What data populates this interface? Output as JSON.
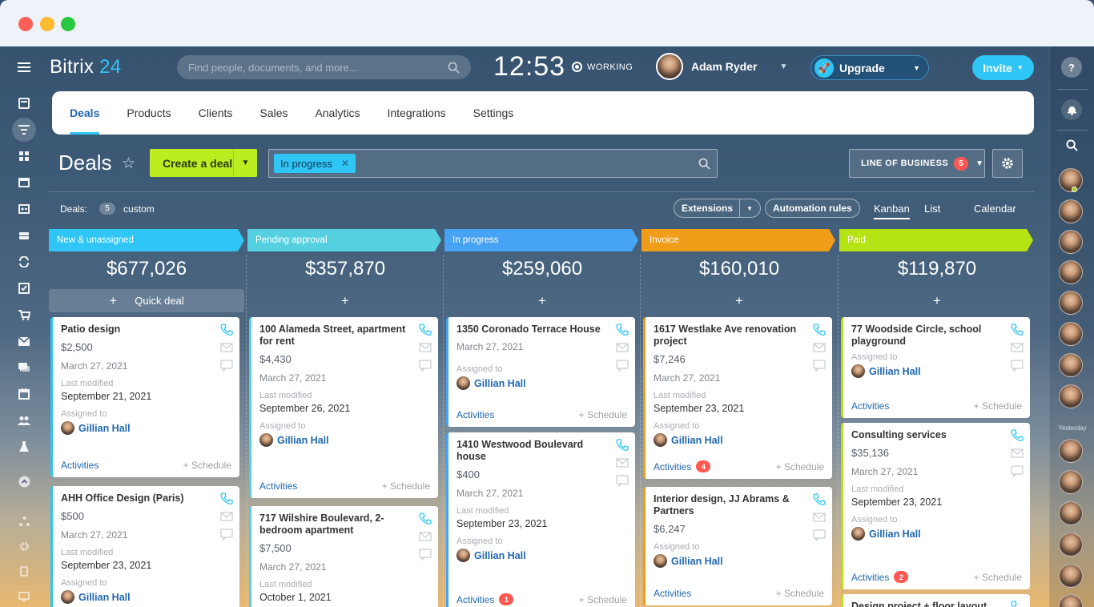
{
  "app": {
    "name_part1": "Bitrix",
    "name_part2": " 24"
  },
  "search": {
    "placeholder": "Find people, documents, and more..."
  },
  "clock": {
    "time": "12:53",
    "status": "WORKING"
  },
  "user": {
    "name": "Adam Ryder"
  },
  "upgrade": {
    "label": "Upgrade"
  },
  "invite": {
    "label": "Invite"
  },
  "tabs": [
    "Deals",
    "Products",
    "Clients",
    "Sales",
    "Analytics",
    "Integrations",
    "Settings"
  ],
  "toolbar": {
    "title": "Deals",
    "create_label": "Create a deal",
    "filter_chip": "In progress",
    "line_of_business": "LINE OF BUSINESS",
    "lob_badge": "5"
  },
  "subbar": {
    "deals_label": "Deals:",
    "deals_count": "5",
    "custom": "custom",
    "extensions": "Extensions",
    "automation": "Automation rules",
    "views": [
      "Kanban",
      "List",
      "Calendar"
    ]
  },
  "right_sidebar": {
    "yesterday": "Yesterday"
  },
  "colors": {
    "new": "#2fc6f6",
    "pending": "#55d0e0",
    "inprogress": "#47a3f3",
    "invoice": "#f09d1a",
    "paid": "#b6e313",
    "link": "#2067b0",
    "primary": "#bbed21"
  },
  "columns": [
    {
      "stage": "New & unassigned",
      "total": "$677,026",
      "quick": "Quick deal",
      "cards": [
        {
          "title": "Patio design",
          "amount": "$2,500",
          "date": "March 27, 2021",
          "last_label": "Last modified",
          "last": "September 21, 2021",
          "assigned_label": "Assigned to",
          "assignee": "Gillian Hall",
          "activities": "Activities",
          "schedule": "+ Schedule"
        },
        {
          "title": "AHH Office Design (Paris)",
          "amount": "$500",
          "date": "March 27, 2021",
          "last_label": "Last modified",
          "last": "September 23, 2021",
          "assigned_label": "Assigned to",
          "assignee": "Gillian Hall"
        }
      ]
    },
    {
      "stage": "Pending approval",
      "total": "$357,870",
      "cards": [
        {
          "title": "100 Alameda Street, apartment for rent",
          "amount": "$4,430",
          "date": "March 27, 2021",
          "last_label": "Last modified",
          "last": "September 26, 2021",
          "assigned_label": "Assigned to",
          "assignee": "Gillian Hall",
          "activities": "Activities",
          "schedule": "+ Schedule"
        },
        {
          "title": "717 Wilshire Boulevard, 2-bedroom apartment",
          "amount": "$7,500",
          "date": "March 27, 2021",
          "last_label": "Last modified",
          "last": "October 1, 2021"
        }
      ]
    },
    {
      "stage": "In progress",
      "total": "$259,060",
      "cards": [
        {
          "title": "1350 Coronado Terrace House",
          "date": "March 27, 2021",
          "assigned_label": "Assigned to",
          "assignee": "Gillian Hall",
          "activities": "Activities",
          "schedule": "+ Schedule"
        },
        {
          "title": "1410 Westwood Boulevard house",
          "amount": "$400",
          "date": "March 27, 2021",
          "last_label": "Last modified",
          "last": "September 23, 2021",
          "assigned_label": "Assigned to",
          "assignee": "Gillian Hall",
          "activities": "Activities",
          "badge": "1",
          "schedule": "+ Schedule"
        }
      ]
    },
    {
      "stage": "Invoice",
      "total": "$160,010",
      "cards": [
        {
          "title": "1617 Westlake Ave renovation project",
          "amount": "$7,246",
          "date": "March 27, 2021",
          "last_label": "Last modified",
          "last": "September 23, 2021",
          "assigned_label": "Assigned to",
          "assignee": "Gillian Hall",
          "activities": "Activities",
          "badge": "4",
          "schedule": "+ Schedule"
        },
        {
          "title": "Interior design, JJ Abrams & Partners",
          "amount": "$6,247",
          "assigned_label": "Assigned to",
          "assignee": "Gillian Hall",
          "activities": "Activities",
          "schedule": "+ Schedule"
        }
      ]
    },
    {
      "stage": "Paid",
      "total": "$119,870",
      "cards": [
        {
          "title": "77 Woodside Circle, school playground",
          "assigned_label": "Assigned to",
          "assignee": "Gillian Hall",
          "activities": "Activities",
          "schedule": "+ Schedule"
        },
        {
          "title": "Consulting services",
          "amount": "$35,136",
          "date": "March 27, 2021",
          "last_label": "Last modified",
          "last": "September 23, 2021",
          "assigned_label": "Assigned to",
          "assignee": "Gillian Hall",
          "activities": "Activities",
          "badge": "2",
          "schedule": "+ Schedule"
        },
        {
          "title": "Design project + floor layout"
        }
      ]
    }
  ]
}
